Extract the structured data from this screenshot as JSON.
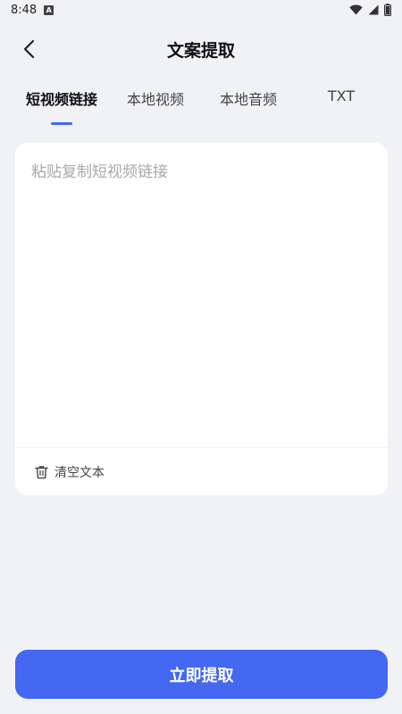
{
  "status_bar": {
    "time": "8:48",
    "notification_badge": "A",
    "icons": [
      "wifi-icon",
      "signal-icon",
      "battery-icon"
    ]
  },
  "header": {
    "title": "文案提取",
    "back_icon": "chevron-left-icon"
  },
  "tabs": [
    {
      "label": "短视频链接",
      "active": true
    },
    {
      "label": "本地视频",
      "active": false
    },
    {
      "label": "本地音频",
      "active": false
    },
    {
      "label": "TXT",
      "active": false
    }
  ],
  "input_card": {
    "value": "",
    "placeholder": "粘贴复制短视频链接",
    "clear_label": "清空文本",
    "clear_icon": "trash-icon"
  },
  "submit": {
    "label": "立即提取"
  },
  "colors": {
    "accent": "#4468f2",
    "background": "#f1f2f6",
    "card": "#ffffff",
    "placeholder": "#a8a8ad"
  }
}
